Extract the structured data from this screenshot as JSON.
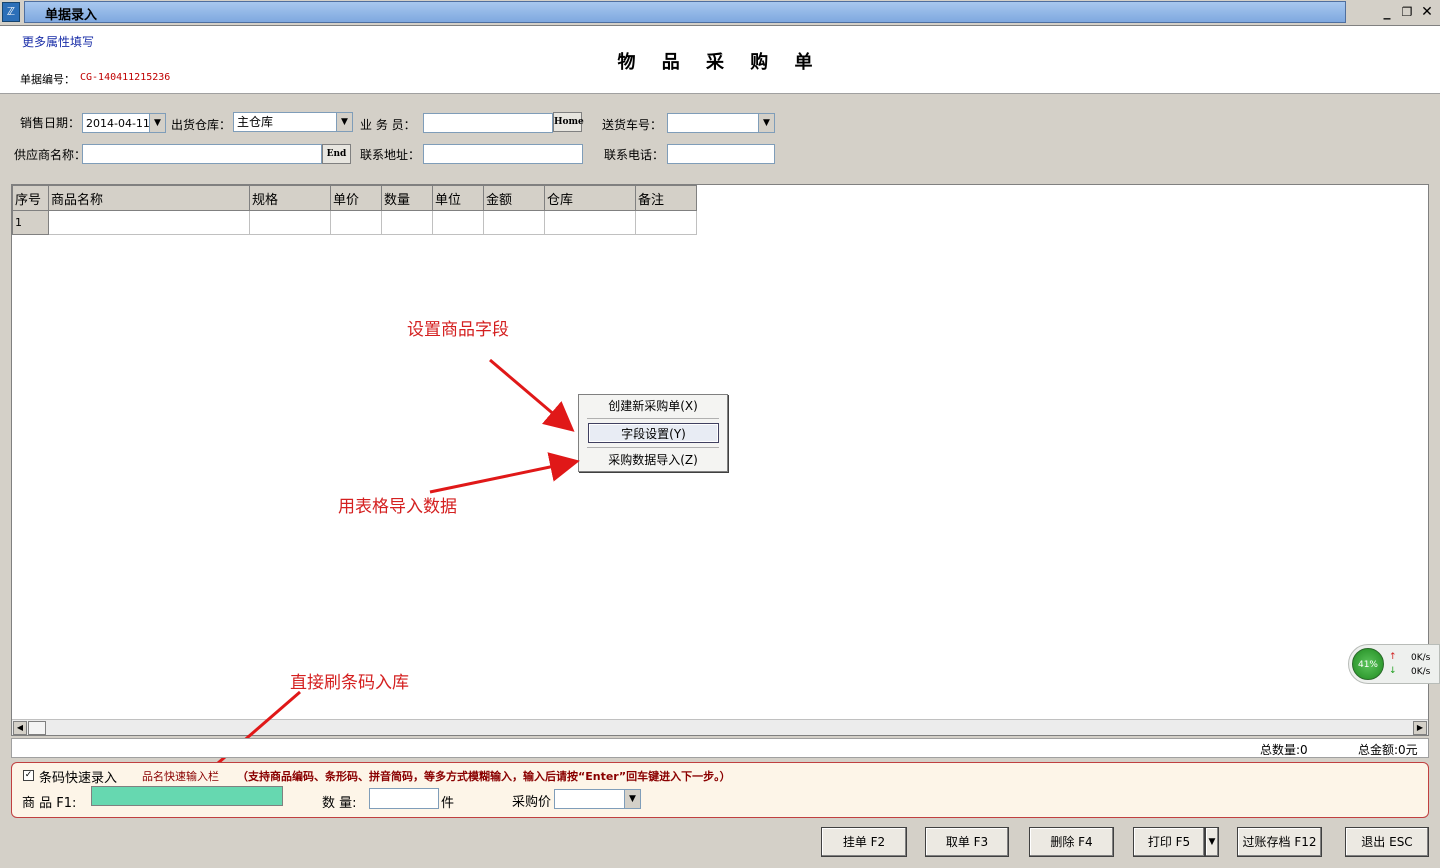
{
  "window": {
    "title": "单据录入",
    "icon_glyph": "ℤ"
  },
  "header": {
    "more_attrs_link": "更多属性填写",
    "doc_title": "物 品 采 购 单",
    "doc_no_label": "单据编号：",
    "doc_no_value": "CG-140411215236"
  },
  "form": {
    "sale_date_label": "销售日期：",
    "sale_date_value": "2014-04-11",
    "warehouse_label": "出货仓库：",
    "warehouse_value": "主仓库",
    "salesman_label": "业 务 员：",
    "salesman_value": "",
    "home_btn": "Home",
    "truck_label": "送货车号：",
    "truck_value": "",
    "supplier_label": "供应商名称：",
    "supplier_value": "",
    "end_btn": "End",
    "address_label": "联系地址：",
    "address_value": "",
    "phone_label": "联系电话：",
    "phone_value": ""
  },
  "grid": {
    "columns": [
      "序号",
      "商品名称",
      "规格",
      "单价",
      "数量",
      "单位",
      "金额",
      "仓库",
      "备注"
    ],
    "rows": [
      [
        "1",
        "",
        "",
        "",
        "",
        "",
        "",
        "",
        ""
      ]
    ]
  },
  "context_menu": {
    "items": [
      {
        "label": "创建新采购单(X)"
      },
      {
        "label": "字段设置(Y)"
      },
      {
        "label": "采购数据导入(Z)"
      }
    ]
  },
  "annotations": {
    "set_fields": "设置商品字段",
    "import_table": "用表格导入数据",
    "barcode_scan": "直接刷条码入库"
  },
  "net_widget": {
    "percent": "41%",
    "up": "0K/s",
    "down": "0K/s"
  },
  "totals": {
    "qty": "总数量:0",
    "amount": "总金额:0元"
  },
  "quick_entry": {
    "checkbox_label": "条码快速录入",
    "checked": true,
    "quick_bar_label": "品名快速输入栏",
    "hint": "（支持商品编码、条形码、拼音简码，等多方式模糊输入，输入后请按“Enter”回车键进入下一步。）",
    "product_label": "商 品 F1:",
    "product_value": "",
    "qty_label": "数 量:",
    "qty_value": "",
    "unit": "件",
    "price_label": "采购价",
    "price_value": ""
  },
  "buttons": {
    "hold": "挂单 F2",
    "fetch": "取单 F3",
    "delete": "删除 F4",
    "print": "打印 F5",
    "post": "过账存档 F12",
    "exit": "退出 ESC"
  },
  "colors": {
    "title_band": "#9ec1ec",
    "annotation": "#d42020",
    "product_input": "#66d8b0",
    "quick_border": "#c04040"
  }
}
